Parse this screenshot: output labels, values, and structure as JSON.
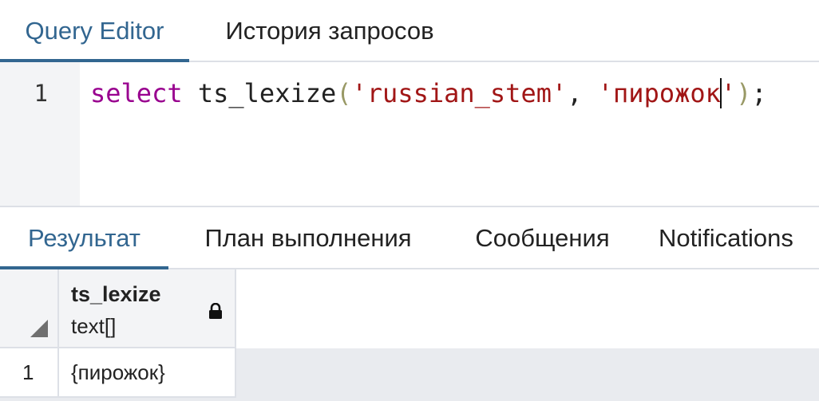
{
  "editor_tabs": [
    {
      "label": "Query Editor",
      "active": true
    },
    {
      "label": "История запросов",
      "active": false
    }
  ],
  "editor": {
    "line_number": "1",
    "tokens": {
      "keyword": "select",
      "space1": " ",
      "function": "ts_lexize",
      "open_paren": "(",
      "arg1": "'russian_stem'",
      "comma": ", ",
      "arg2_before_cursor": "'пирожок",
      "arg2_after_cursor": "'",
      "close_paren": ")",
      "semicolon": ";"
    }
  },
  "result_tabs": [
    {
      "label": "Результат",
      "active": true
    },
    {
      "label": "План выполнения",
      "active": false
    },
    {
      "label": "Сообщения",
      "active": false
    },
    {
      "label": "Notifications",
      "active": false
    }
  ],
  "grid": {
    "columns": [
      {
        "name": "ts_lexize",
        "type": "text[]",
        "read_only_icon": "lock-icon"
      }
    ],
    "rows": [
      {
        "number": "1",
        "cells": [
          "{пирожок}"
        ]
      }
    ]
  },
  "colors": {
    "accent": "#326690",
    "keyword": "#99008f",
    "string": "#a11616"
  }
}
